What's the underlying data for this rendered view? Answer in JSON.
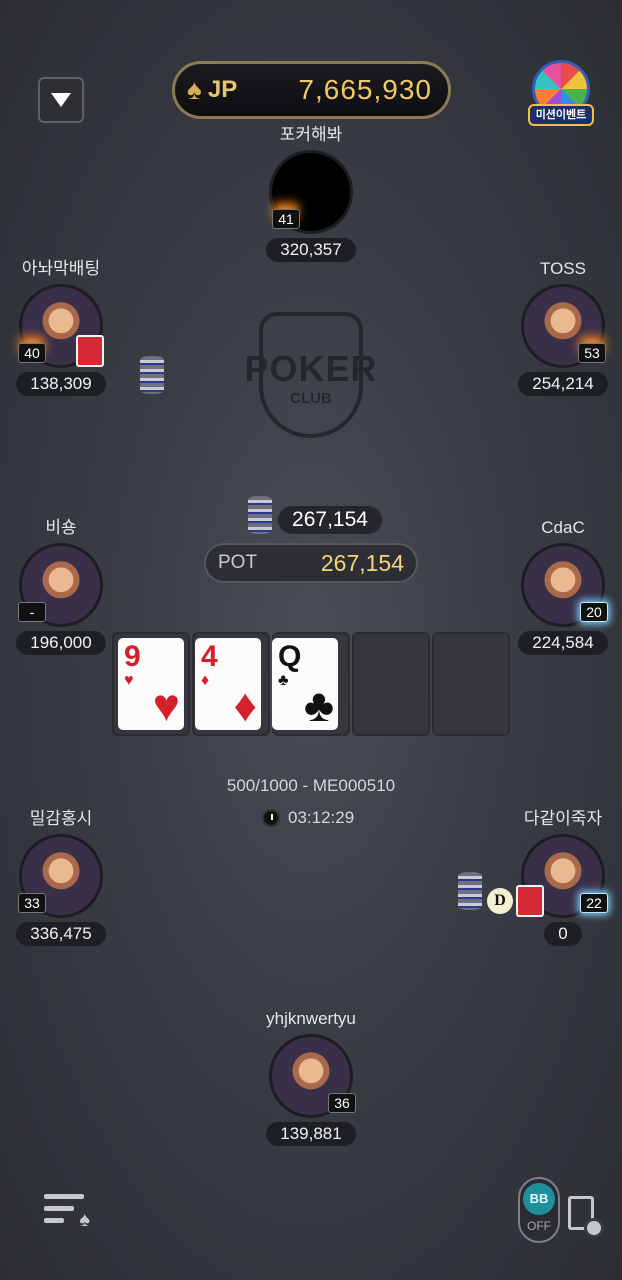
{
  "jackpot": {
    "label": "JP",
    "value": "7,665,930"
  },
  "mission_event": {
    "label": "미션이벤트"
  },
  "logo": {
    "main": "POKER",
    "sub": "CLUB"
  },
  "players": [
    {
      "name": "포커해봐",
      "level": "41",
      "stack": "320,357"
    },
    {
      "name": "아놔막배팅",
      "level": "40",
      "stack": "138,309"
    },
    {
      "name": "TOSS",
      "level": "53",
      "stack": "254,214"
    },
    {
      "name": "비숑",
      "level": "-",
      "stack": "196,000"
    },
    {
      "name": "CdaC",
      "level": "20",
      "stack": "224,584"
    },
    {
      "name": "밀감홍시",
      "level": "33",
      "stack": "336,475"
    },
    {
      "name": "다같이죽자",
      "level": "22",
      "stack": "0"
    },
    {
      "name": "yhjknwertyu",
      "level": "36",
      "stack": "139,881"
    }
  ],
  "bet": "267,154",
  "pot": {
    "label": "POT",
    "value": "267,154"
  },
  "board": [
    {
      "rank": "9",
      "suit": "♥",
      "color": "red"
    },
    {
      "rank": "4",
      "suit": "♦",
      "color": "red"
    },
    {
      "rank": "Q",
      "suit": "♣",
      "color": "black"
    }
  ],
  "dealer_button": "D",
  "blinds_info": "500/1000 - ME000510",
  "timer": "03:12:29",
  "bb_toggle": {
    "top": "BB",
    "bottom": "OFF"
  }
}
